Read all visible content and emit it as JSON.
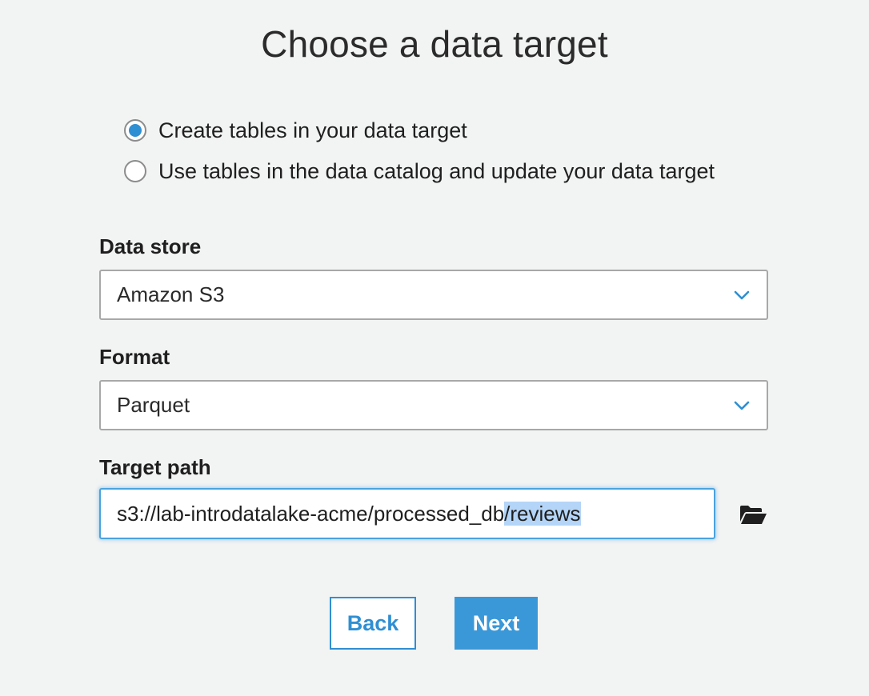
{
  "page": {
    "title": "Choose a data target"
  },
  "target_mode": {
    "options": [
      {
        "label": "Create tables in your data target",
        "selected": true
      },
      {
        "label": "Use tables in the data catalog and update your data target",
        "selected": false
      }
    ]
  },
  "data_store": {
    "label": "Data store",
    "value": "Amazon S3"
  },
  "format": {
    "label": "Format",
    "value": "Parquet"
  },
  "target_path": {
    "label": "Target path",
    "value_prefix": "s3://lab-introdatalake-acme/processed_db",
    "value_selected": "/reviews",
    "icon": "folder-open-icon"
  },
  "buttons": {
    "back_label": "Back",
    "next_label": "Next"
  },
  "colors": {
    "accent": "#2f8fd3",
    "background": "#f2f3f3",
    "selection": "#b4d5f7"
  }
}
